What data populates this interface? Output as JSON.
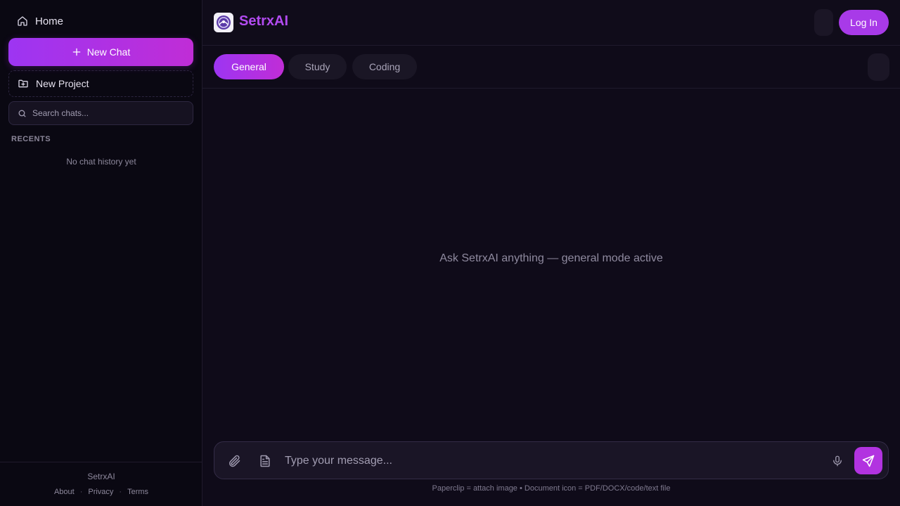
{
  "sidebar": {
    "home_label": "Home",
    "new_chat_label": "New Chat",
    "new_project_label": "New Project",
    "search_placeholder": "Search chats...",
    "recents_title": "RECENTS",
    "empty_history": "No chat history yet",
    "footer": {
      "brand": "SetrxAI",
      "links": [
        "About",
        "Privacy",
        "Terms"
      ]
    }
  },
  "header": {
    "brand": "SetrxAI",
    "login_label": "Log In"
  },
  "tabs": [
    {
      "label": "General",
      "active": true
    },
    {
      "label": "Study",
      "active": false
    },
    {
      "label": "Coding",
      "active": false
    }
  ],
  "main": {
    "empty_state": "Ask SetrxAI anything — general mode active"
  },
  "composer": {
    "placeholder": "Type your message...",
    "hint": "Paperclip = attach image  •  Document icon = PDF/DOCX/code/text file"
  },
  "colors": {
    "accent": "#a83ae8",
    "brand_text": "#b24bf0",
    "background": "#0f0b19"
  },
  "icons": {
    "home": "home-icon",
    "new_chat": "plus-icon",
    "new_project": "folder-plus-icon",
    "search": "search-icon",
    "attach": "paperclip-icon",
    "document": "document-icon",
    "mic": "microphone-icon",
    "send": "send-icon"
  }
}
